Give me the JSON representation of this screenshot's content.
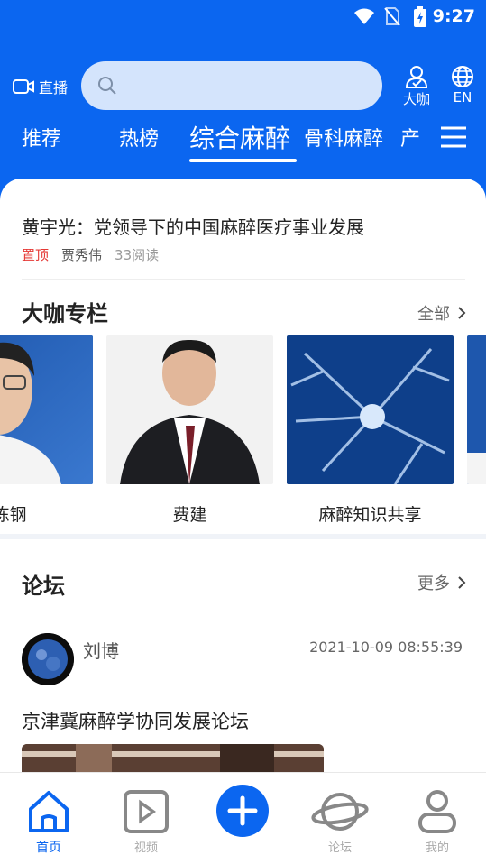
{
  "status_bar": {
    "time": "9:27"
  },
  "header": {
    "live_label": "直播",
    "search_placeholder": "",
    "experts_label": "大咖",
    "lang_label": "EN"
  },
  "tabs": [
    {
      "label": "推荐",
      "active": false
    },
    {
      "label": "热榜",
      "active": false
    },
    {
      "label": "综合麻醉",
      "active": true
    },
    {
      "label": "骨科麻醉",
      "active": false
    },
    {
      "label": "产",
      "active": false
    }
  ],
  "article": {
    "title": "黄宇光：党领导下的中国麻醉医疗事业发展",
    "pin": "置顶",
    "author": "贾秀伟",
    "reads": "33阅读"
  },
  "experts_section": {
    "title": "大咖专栏",
    "more": "全部",
    "cards": [
      {
        "label": "陈钢"
      },
      {
        "label": "费建"
      },
      {
        "label": "麻醉知识共享"
      }
    ]
  },
  "forum_section": {
    "title": "论坛",
    "more": "更多",
    "post": {
      "user": "刘博",
      "datetime": "2021-10-09 08:55:39",
      "title": "京津冀麻醉学协同发展论坛"
    }
  },
  "bottom_nav": [
    {
      "label": "首页",
      "icon": "home-icon",
      "active": true
    },
    {
      "label": "视频",
      "icon": "video-icon",
      "active": false
    },
    {
      "label": "",
      "icon": "plus-icon",
      "active": false
    },
    {
      "label": "论坛",
      "icon": "planet-icon",
      "active": false
    },
    {
      "label": "我的",
      "icon": "user-icon",
      "active": false
    }
  ],
  "colors": {
    "primary": "#0b66f0",
    "pin": "#e53935"
  }
}
